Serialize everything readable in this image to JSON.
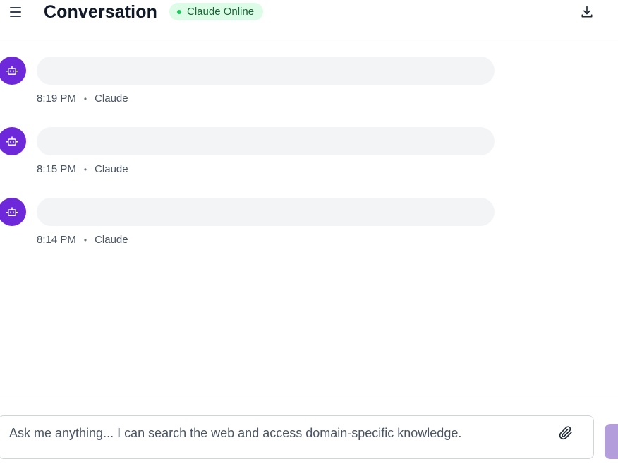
{
  "header": {
    "title": "Conversation",
    "status": "Claude Online",
    "menu_icon": "menu-icon",
    "export_icon": "download-icon"
  },
  "messages": [
    {
      "time": "8:19 PM",
      "sender": "Claude",
      "separator": "•",
      "text": ""
    },
    {
      "time": "8:15 PM",
      "sender": "Claude",
      "separator": "•",
      "text": ""
    },
    {
      "time": "8:14 PM",
      "sender": "Claude",
      "separator": "•",
      "text": ""
    }
  ],
  "composer": {
    "placeholder": "Ask me anything... I can search the web and access domain-specific knowledge.",
    "value": "",
    "attach_icon": "paperclip-icon"
  },
  "colors": {
    "accent": "#6d28d9",
    "status_bg": "#dcfce7",
    "status_dot": "#22c55e",
    "bubble_bg": "#f3f4f6",
    "send_button": "#b39ddb"
  }
}
